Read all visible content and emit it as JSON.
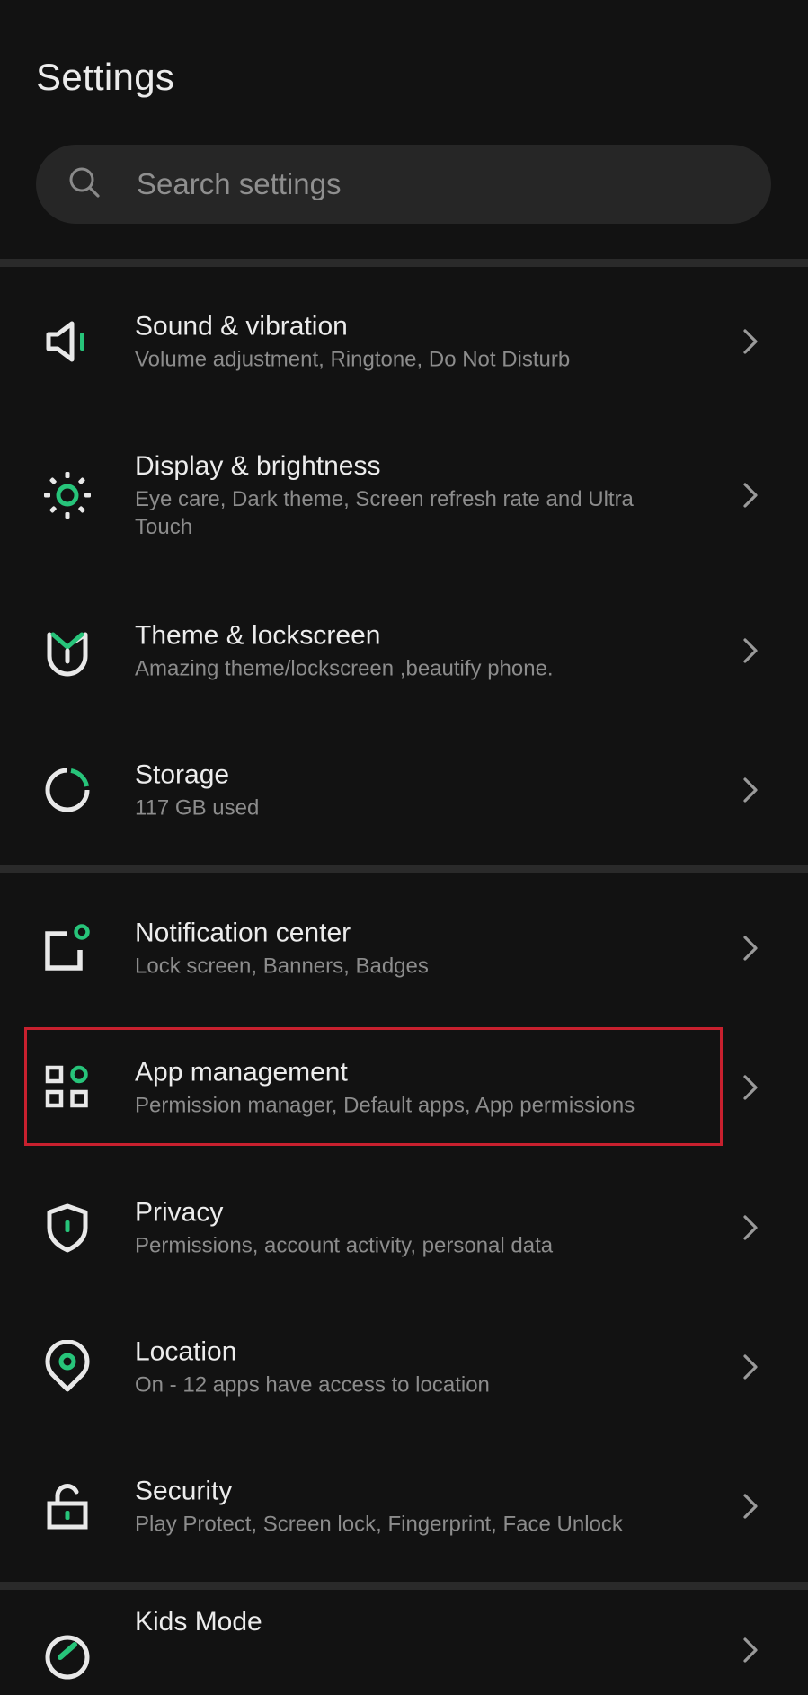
{
  "header": {
    "title": "Settings"
  },
  "search": {
    "placeholder": "Search settings",
    "icon": "search-icon"
  },
  "colors": {
    "background": "#121212",
    "accent": "#27c47a",
    "highlight": "#c8202e",
    "icon": "#e8e8e8",
    "subtitle": "#8c8c8c"
  },
  "settings": {
    "items": [
      {
        "title": "Sound & vibration",
        "subtitle": "Volume adjustment, Ringtone, Do Not Disturb",
        "icon": "speaker-icon"
      },
      {
        "title": "Display & brightness",
        "subtitle": "Eye care, Dark theme, Screen refresh rate and Ultra Touch",
        "icon": "sun-icon"
      },
      {
        "title": "Theme & lockscreen",
        "subtitle": "Amazing theme/lockscreen ,beautify phone.",
        "icon": "theme-icon"
      },
      {
        "title": "Storage",
        "subtitle": "117 GB used",
        "icon": "storage-ring-icon"
      },
      {
        "title": "Notification center",
        "subtitle": "Lock screen, Banners, Badges",
        "icon": "notification-icon"
      },
      {
        "title": "App management",
        "subtitle": "Permission manager, Default apps, App permissions",
        "icon": "apps-grid-icon",
        "highlighted": true
      },
      {
        "title": "Privacy",
        "subtitle": "Permissions, account activity, personal data",
        "icon": "shield-icon"
      },
      {
        "title": "Location",
        "subtitle": "On - 12 apps have access to location",
        "icon": "location-pin-icon"
      },
      {
        "title": "Security",
        "subtitle": "Play Protect, Screen lock, Fingerprint, Face Unlock",
        "icon": "padlock-icon"
      },
      {
        "title": "Kids Mode",
        "subtitle": "",
        "icon": "kids-mode-icon"
      }
    ]
  }
}
